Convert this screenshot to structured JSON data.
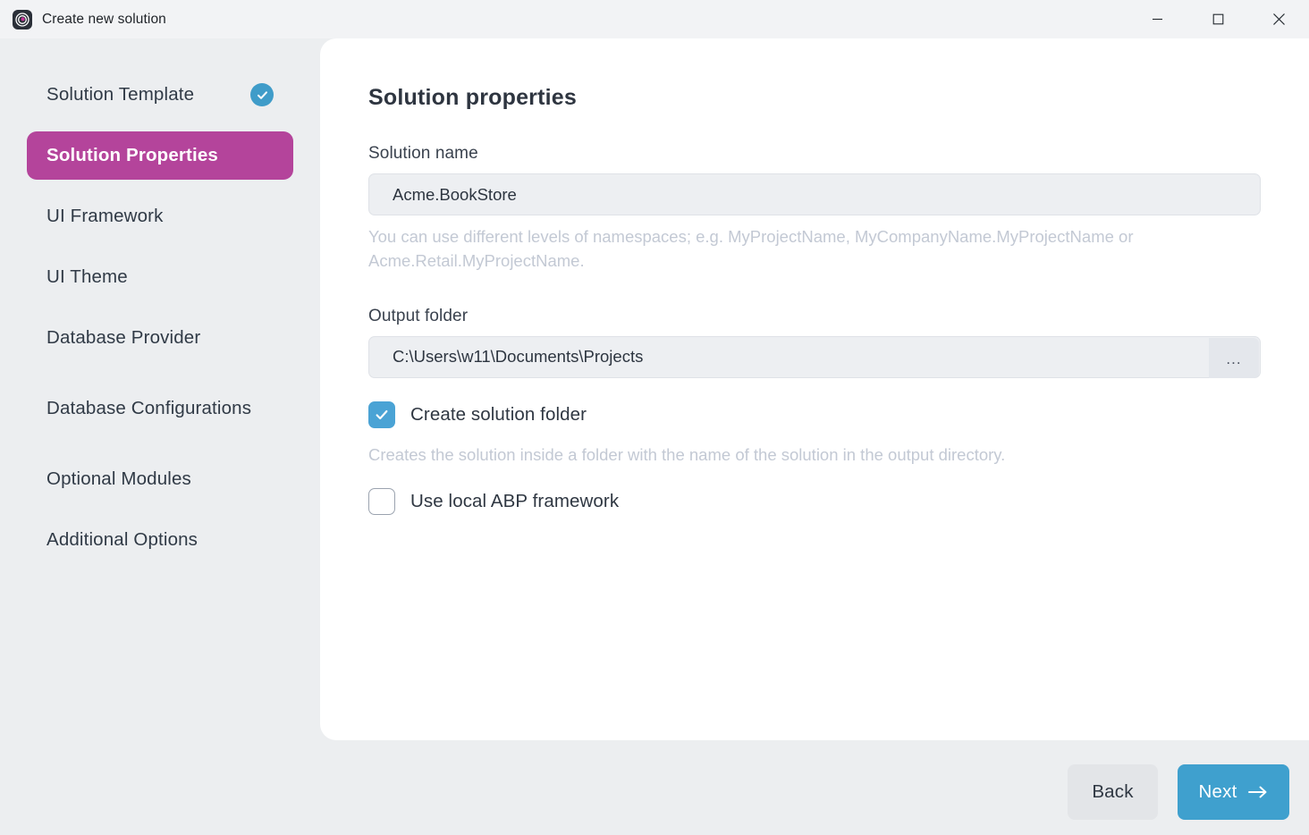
{
  "window": {
    "title": "Create new solution",
    "app_icon": "abp-logo-icon",
    "controls": {
      "minimize": "minimize-icon",
      "maximize": "maximize-icon",
      "close": "close-icon"
    }
  },
  "sidebar": {
    "items": [
      {
        "label": "Solution Template",
        "state": "completed",
        "check_icon": "check-circle-icon"
      },
      {
        "label": "Solution Properties",
        "state": "active"
      },
      {
        "label": "UI Framework",
        "state": "default"
      },
      {
        "label": "UI Theme",
        "state": "default"
      },
      {
        "label": "Database Provider",
        "state": "default"
      },
      {
        "label": "Database Configurations",
        "state": "default"
      },
      {
        "label": "Optional Modules",
        "state": "default"
      },
      {
        "label": "Additional Options",
        "state": "default"
      }
    ]
  },
  "main": {
    "title": "Solution properties",
    "solution_name": {
      "label": "Solution name",
      "value": "Acme.BookStore",
      "placeholder": "Solution name",
      "helper": "You can use different levels of namespaces; e.g. MyProjectName, MyCompanyName.MyProjectName or Acme.Retail.MyProjectName."
    },
    "output_folder": {
      "label": "Output folder",
      "value": "C:\\Users\\w11\\Documents\\Projects",
      "placeholder": "Output folder",
      "browse_label": "..."
    },
    "create_solution_folder": {
      "label": "Create solution folder",
      "checked": true,
      "helper": "Creates the solution inside a folder with the name of the solution in the output directory."
    },
    "use_local_abp": {
      "label": "Use local ABP framework",
      "checked": false
    }
  },
  "footer": {
    "back_label": "Back",
    "next_label": "Next",
    "next_icon": "arrow-right-icon"
  },
  "colors": {
    "accent_blue": "#3fa0ce",
    "accent_magenta": "#b4449b",
    "background": "#eceef0",
    "panel": "#ffffff",
    "helper_text": "#c3c9d4"
  }
}
